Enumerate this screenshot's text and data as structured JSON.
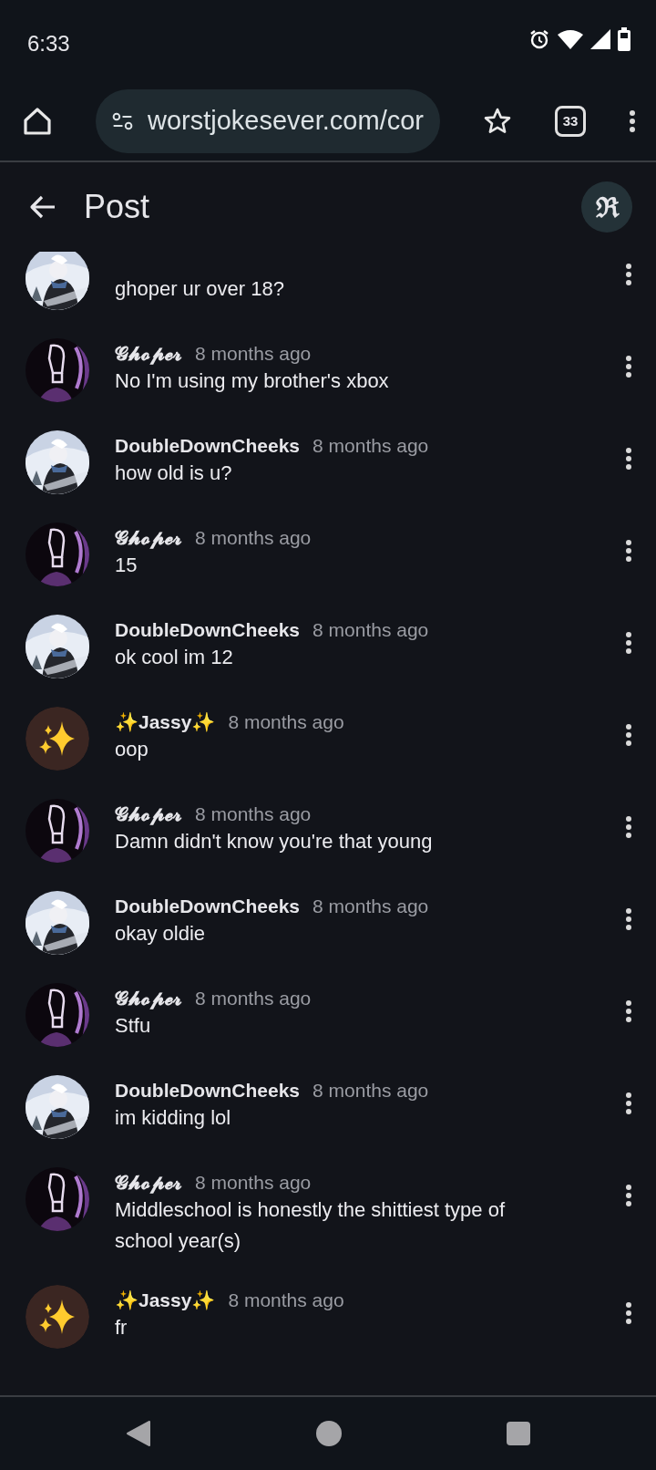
{
  "status_bar": {
    "time": "6:33"
  },
  "browser": {
    "url": "worstjokesever.com/cor",
    "tab_count": "33"
  },
  "app_bar": {
    "title": "Post",
    "profile_initial": "ℜ"
  },
  "comments": [
    {
      "kind": "snow",
      "text": "ghoper ur over 18?"
    },
    {
      "kind": "purple",
      "author": "𝓖𝓱𝓸𝓹𝓮𝓻",
      "time": "8 months ago",
      "text": "No I'm using my brother's xbox"
    },
    {
      "kind": "snow",
      "author": "DoubleDownCheeks",
      "time": "8 months ago",
      "text": "how old is u?"
    },
    {
      "kind": "purple",
      "author": "𝓖𝓱𝓸𝓹𝓮𝓻",
      "time": "8 months ago",
      "text": "15"
    },
    {
      "kind": "snow",
      "author": "DoubleDownCheeks",
      "time": "8 months ago",
      "text": "ok cool im 12"
    },
    {
      "kind": "sparkle",
      "author": "✨Jassy✨",
      "time": "8 months ago",
      "text": "oop"
    },
    {
      "kind": "purple",
      "author": "𝓖𝓱𝓸𝓹𝓮𝓻",
      "time": "8 months ago",
      "text": "Damn didn't know you're that young"
    },
    {
      "kind": "snow",
      "author": "DoubleDownCheeks",
      "time": "8 months ago",
      "text": "okay oldie"
    },
    {
      "kind": "purple",
      "author": "𝓖𝓱𝓸𝓹𝓮𝓻",
      "time": "8 months ago",
      "text": "Stfu"
    },
    {
      "kind": "snow",
      "author": "DoubleDownCheeks",
      "time": "8 months ago",
      "text": "im kidding lol"
    },
    {
      "kind": "purple",
      "author": "𝓖𝓱𝓸𝓹𝓮𝓻",
      "time": "8 months ago",
      "text": "Middleschool is honestly the shittiest type of school year(s)"
    },
    {
      "kind": "sparkle",
      "author": "✨Jassy✨",
      "time": "8 months ago",
      "text": "fr"
    }
  ]
}
